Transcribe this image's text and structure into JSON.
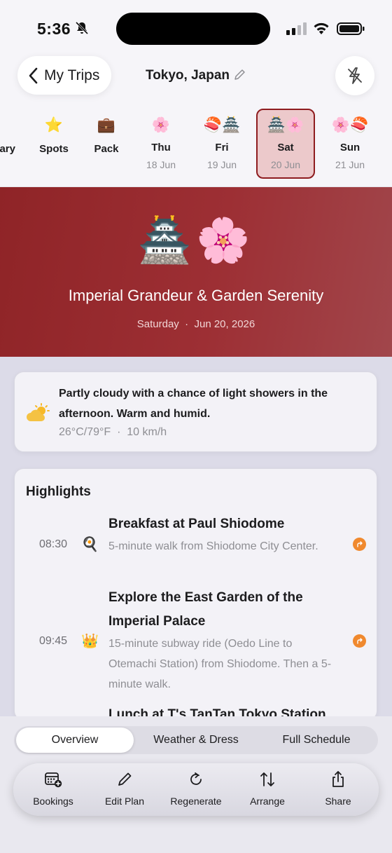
{
  "status": {
    "time": "5:36"
  },
  "nav": {
    "back_label": "My Trips",
    "title": "Tokyo, Japan"
  },
  "tabs": [
    {
      "emoji": "",
      "name": "ary",
      "date": ""
    },
    {
      "emoji": "⭐",
      "name": "Spots",
      "date": ""
    },
    {
      "emoji": "💼",
      "name": "Pack",
      "date": ""
    },
    {
      "emoji": "🌸",
      "name": "Thu",
      "date": "18 Jun"
    },
    {
      "emoji": "🍣🏯",
      "name": "Fri",
      "date": "19 Jun"
    },
    {
      "emoji": "🏯🌸",
      "name": "Sat",
      "date": "20 Jun"
    },
    {
      "emoji": "🌸🍣",
      "name": "Sun",
      "date": "21 Jun"
    }
  ],
  "hero": {
    "emoji": "🏯🌸",
    "title": "Imperial Grandeur & Garden Serenity",
    "day": "Saturday",
    "sep": "·",
    "date": "Jun 20, 2026"
  },
  "weather": {
    "description": "Partly cloudy with a chance of light showers in the afternoon. Warm and humid.",
    "temp": "26°C/79°F",
    "sep": "·",
    "wind": "10 km/h"
  },
  "highlights": {
    "heading": "Highlights",
    "items": [
      {
        "time": "08:30",
        "emoji": "🍳",
        "title": "Breakfast at Paul Shiodome",
        "desc": "5-minute walk from Shiodome City Center."
      },
      {
        "time": "09:45",
        "emoji": "👑",
        "title": "Explore the East Garden of the Imperial Palace",
        "desc": "15-minute subway ride (Oedo Line to Otemachi Station) from Shiodome. Then a 5-minute walk."
      },
      {
        "time": "",
        "emoji": "",
        "title": "Lunch at T's TanTan Tokyo Station",
        "desc": ""
      }
    ]
  },
  "segments": [
    "Overview",
    "Weather & Dress",
    "Full Schedule"
  ],
  "toolbar": [
    "Bookings",
    "Edit Plan",
    "Regenerate",
    "Arrange",
    "Share"
  ],
  "colors": {
    "accent": "#8e1c1f",
    "hero": "#9a2a2e",
    "orange": "#f0892e"
  }
}
